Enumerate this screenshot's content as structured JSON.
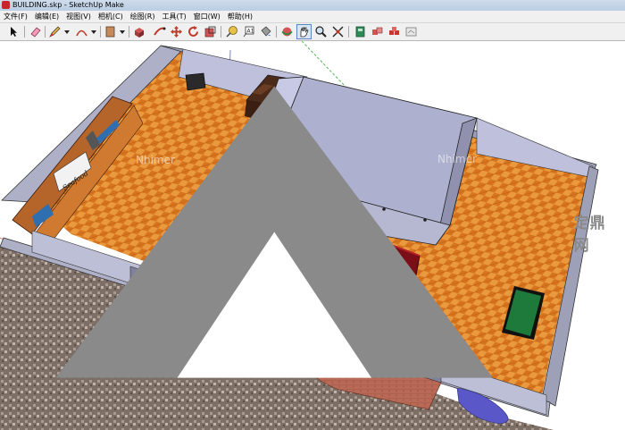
{
  "window": {
    "title": "BUILDING.skp - SketchUp Make"
  },
  "menu": [
    "文件(F)",
    "编辑(E)",
    "视图(V)",
    "相机(C)",
    "绘图(R)",
    "工具(T)",
    "窗口(W)",
    "帮助(H)"
  ],
  "toolbar_tools": [
    "select-tool",
    "eraser-tool",
    "line-tool",
    "arc-tool",
    "rectangle-tool",
    "push-pull-tool",
    "move-tool",
    "rotate-tool",
    "offset-tool",
    "tape-measure-tool",
    "text-tool",
    "paint-bucket-tool",
    "orbit-tool",
    "pan-tool",
    "zoom-tool",
    "zoom-extents-tool",
    "get-models",
    "share-model",
    "extension-warehouse",
    "layout-tool"
  ],
  "model": {
    "sign_text": "Seafood"
  },
  "watermarks": {
    "viewport": "Nhimer",
    "site_logo": "定鼎网"
  }
}
